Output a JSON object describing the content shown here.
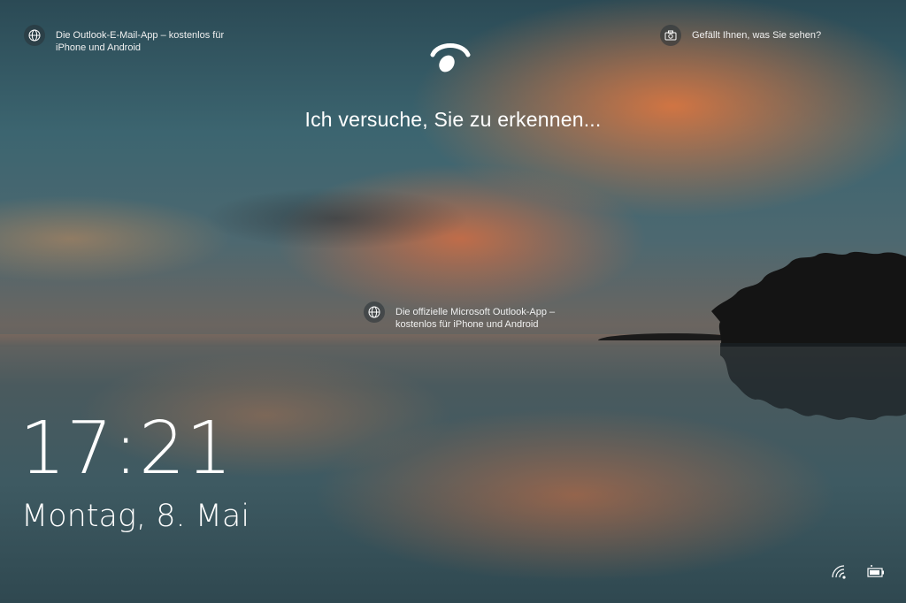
{
  "spotlight": {
    "top_left": {
      "icon": "globe-icon",
      "text": "Die Outlook-E-Mail-App – kostenlos für iPhone und Android"
    },
    "top_right": {
      "icon": "camera-icon",
      "text": "Gefällt Ihnen, was Sie sehen?"
    },
    "middle": {
      "icon": "globe-icon",
      "text": "Die offizielle Microsoft Outlook-App – kostenlos für iPhone und Android"
    }
  },
  "windows_hello": {
    "icon": "face-recognition-icon",
    "message": "Ich versuche, Sie zu erkennen..."
  },
  "lockscreen": {
    "time": "17:21",
    "date": "Montag, 8. Mai"
  },
  "system_tray": {
    "network_icon": "wifi-icon",
    "battery_icon": "battery-icon"
  },
  "colors": {
    "text": "#ffffff",
    "sky_orange": "#eb783c",
    "water_teal": "#3e5a62"
  }
}
